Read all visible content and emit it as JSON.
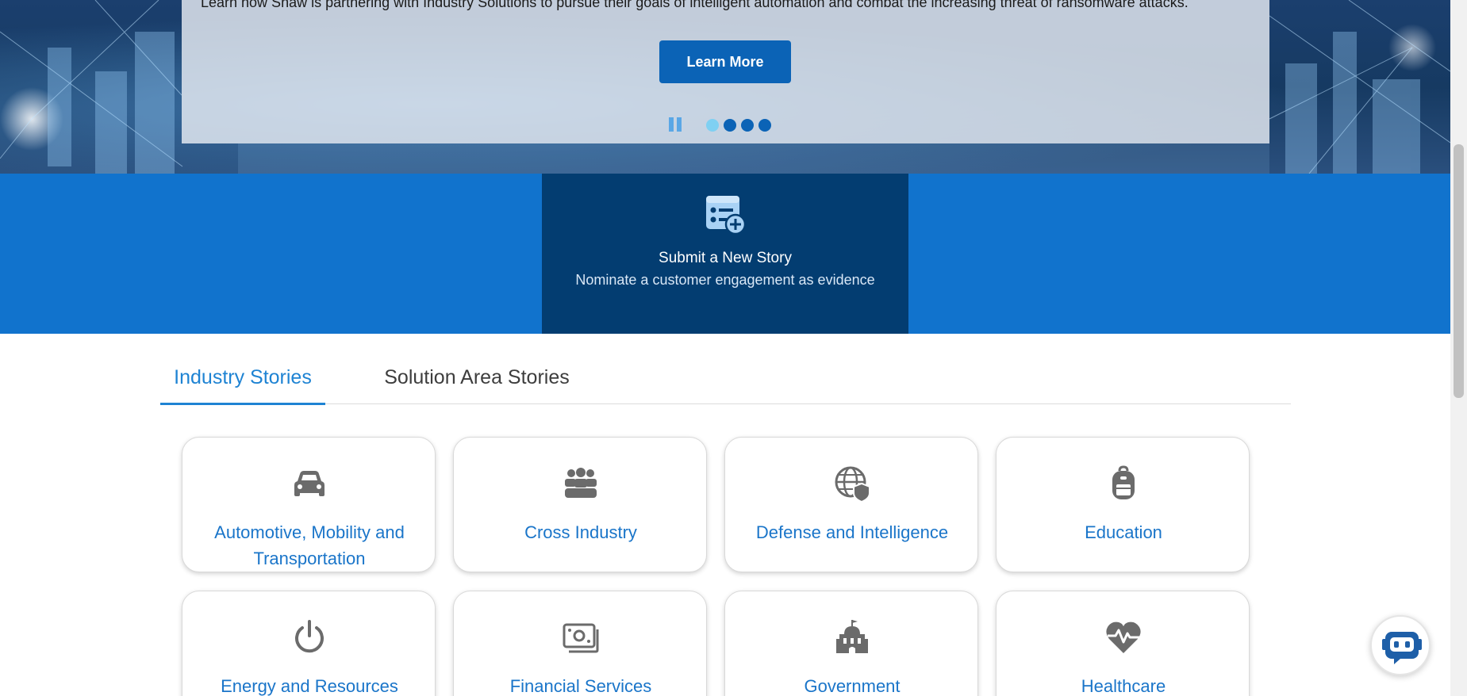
{
  "hero": {
    "text": "Learn how Shaw is partnering with Industry Solutions to pursue their goals of intelligent automation and combat the increasing threat of ransomware attacks.",
    "cta_label": "Learn More",
    "slide_count": 4,
    "active_slide": 1
  },
  "submit": {
    "title": "Submit a New Story",
    "subtitle": "Nominate a customer engagement as evidence"
  },
  "tabs": [
    {
      "label": "Industry Stories",
      "active": true
    },
    {
      "label": "Solution Area Stories",
      "active": false
    }
  ],
  "industries": [
    {
      "label": "Automotive, Mobility and Transportation",
      "icon": "car-icon"
    },
    {
      "label": "Cross Industry",
      "icon": "people-group-icon"
    },
    {
      "label": "Defense and Intelligence",
      "icon": "globe-shield-icon"
    },
    {
      "label": "Education",
      "icon": "backpack-icon"
    },
    {
      "label": "Energy and Resources",
      "icon": "power-icon"
    },
    {
      "label": "Financial Services",
      "icon": "money-bill-icon"
    },
    {
      "label": "Government",
      "icon": "government-building-icon"
    },
    {
      "label": "Healthcare",
      "icon": "heart-pulse-icon"
    }
  ],
  "colors": {
    "brand_blue": "#1173cd",
    "dark_blue": "#033d71",
    "link_blue": "#1a75c9",
    "button_blue": "#0b63b6",
    "icon_gray": "#6b6b6b"
  }
}
